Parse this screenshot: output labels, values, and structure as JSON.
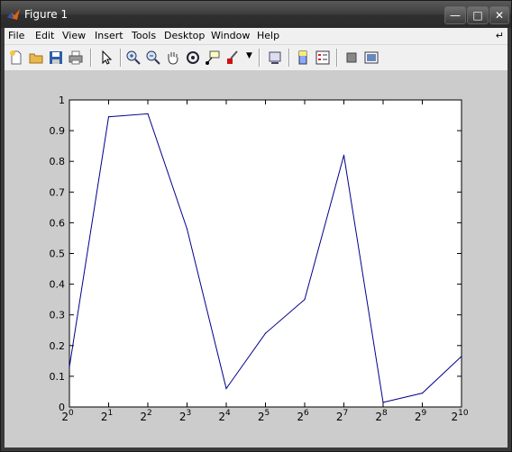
{
  "window": {
    "title": "Figure 1"
  },
  "menu": [
    "File",
    "Edit",
    "View",
    "Insert",
    "Tools",
    "Desktop",
    "Window",
    "Help"
  ],
  "toolbar": [
    "new-file-icon",
    "open-folder-icon",
    "save-icon",
    "print-icon",
    "pointer-icon",
    "zoom-in-icon",
    "zoom-out-icon",
    "pan-hand-icon",
    "rotate-3d-icon",
    "data-cursor-icon",
    "brush-icon",
    "brush-dropdown-icon",
    "link-plot-icon",
    "colorbar-icon",
    "legend-icon",
    "hide-plot-tools-icon",
    "show-plot-tools-icon"
  ],
  "chart_data": {
    "type": "line",
    "x": [
      1,
      2,
      4,
      8,
      16,
      32,
      64,
      128,
      256,
      512,
      1024
    ],
    "series": [
      {
        "values": [
          0.13,
          0.945,
          0.955,
          0.58,
          0.06,
          0.24,
          0.35,
          0.82,
          0.015,
          0.045,
          0.165
        ],
        "color": "#00008b"
      }
    ],
    "xscale": "log2",
    "xlim": [
      1,
      1024
    ],
    "ylim": [
      0,
      1
    ],
    "yticks": [
      "0",
      "0.1",
      "0.2",
      "0.3",
      "0.4",
      "0.5",
      "0.6",
      "0.7",
      "0.8",
      "0.9",
      "1"
    ],
    "xticks": [
      {
        "base": "2",
        "exp": "0"
      },
      {
        "base": "2",
        "exp": "1"
      },
      {
        "base": "2",
        "exp": "2"
      },
      {
        "base": "2",
        "exp": "3"
      },
      {
        "base": "2",
        "exp": "4"
      },
      {
        "base": "2",
        "exp": "5"
      },
      {
        "base": "2",
        "exp": "6"
      },
      {
        "base": "2",
        "exp": "7"
      },
      {
        "base": "2",
        "exp": "8"
      },
      {
        "base": "2",
        "exp": "9"
      },
      {
        "base": "2",
        "exp": "10"
      }
    ],
    "grid": false
  }
}
